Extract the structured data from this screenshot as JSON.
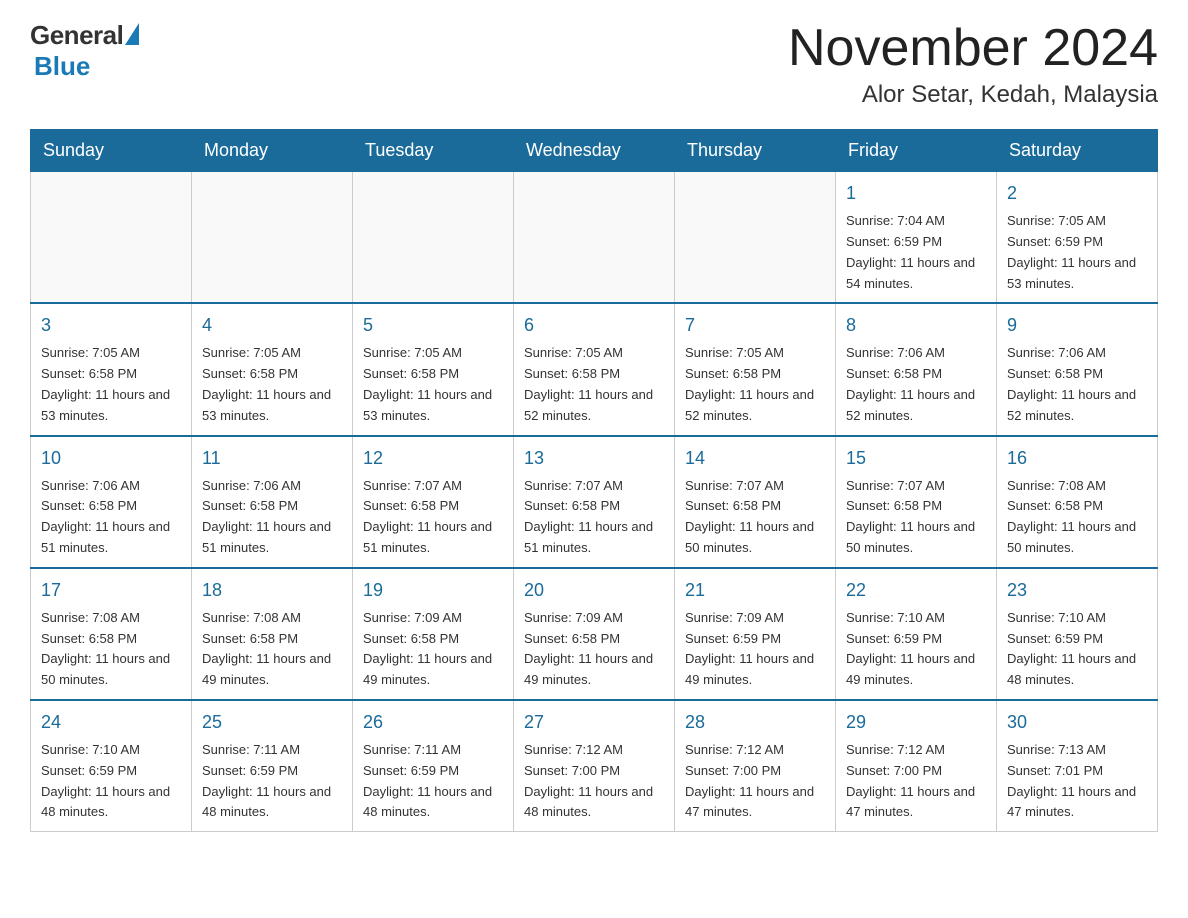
{
  "header": {
    "logo_general": "General",
    "logo_blue": "Blue",
    "month_title": "November 2024",
    "location": "Alor Setar, Kedah, Malaysia"
  },
  "days_of_week": [
    "Sunday",
    "Monday",
    "Tuesday",
    "Wednesday",
    "Thursday",
    "Friday",
    "Saturday"
  ],
  "weeks": [
    [
      {
        "day": "",
        "info": ""
      },
      {
        "day": "",
        "info": ""
      },
      {
        "day": "",
        "info": ""
      },
      {
        "day": "",
        "info": ""
      },
      {
        "day": "",
        "info": ""
      },
      {
        "day": "1",
        "info": "Sunrise: 7:04 AM\nSunset: 6:59 PM\nDaylight: 11 hours and 54 minutes."
      },
      {
        "day": "2",
        "info": "Sunrise: 7:05 AM\nSunset: 6:59 PM\nDaylight: 11 hours and 53 minutes."
      }
    ],
    [
      {
        "day": "3",
        "info": "Sunrise: 7:05 AM\nSunset: 6:58 PM\nDaylight: 11 hours and 53 minutes."
      },
      {
        "day": "4",
        "info": "Sunrise: 7:05 AM\nSunset: 6:58 PM\nDaylight: 11 hours and 53 minutes."
      },
      {
        "day": "5",
        "info": "Sunrise: 7:05 AM\nSunset: 6:58 PM\nDaylight: 11 hours and 53 minutes."
      },
      {
        "day": "6",
        "info": "Sunrise: 7:05 AM\nSunset: 6:58 PM\nDaylight: 11 hours and 52 minutes."
      },
      {
        "day": "7",
        "info": "Sunrise: 7:05 AM\nSunset: 6:58 PM\nDaylight: 11 hours and 52 minutes."
      },
      {
        "day": "8",
        "info": "Sunrise: 7:06 AM\nSunset: 6:58 PM\nDaylight: 11 hours and 52 minutes."
      },
      {
        "day": "9",
        "info": "Sunrise: 7:06 AM\nSunset: 6:58 PM\nDaylight: 11 hours and 52 minutes."
      }
    ],
    [
      {
        "day": "10",
        "info": "Sunrise: 7:06 AM\nSunset: 6:58 PM\nDaylight: 11 hours and 51 minutes."
      },
      {
        "day": "11",
        "info": "Sunrise: 7:06 AM\nSunset: 6:58 PM\nDaylight: 11 hours and 51 minutes."
      },
      {
        "day": "12",
        "info": "Sunrise: 7:07 AM\nSunset: 6:58 PM\nDaylight: 11 hours and 51 minutes."
      },
      {
        "day": "13",
        "info": "Sunrise: 7:07 AM\nSunset: 6:58 PM\nDaylight: 11 hours and 51 minutes."
      },
      {
        "day": "14",
        "info": "Sunrise: 7:07 AM\nSunset: 6:58 PM\nDaylight: 11 hours and 50 minutes."
      },
      {
        "day": "15",
        "info": "Sunrise: 7:07 AM\nSunset: 6:58 PM\nDaylight: 11 hours and 50 minutes."
      },
      {
        "day": "16",
        "info": "Sunrise: 7:08 AM\nSunset: 6:58 PM\nDaylight: 11 hours and 50 minutes."
      }
    ],
    [
      {
        "day": "17",
        "info": "Sunrise: 7:08 AM\nSunset: 6:58 PM\nDaylight: 11 hours and 50 minutes."
      },
      {
        "day": "18",
        "info": "Sunrise: 7:08 AM\nSunset: 6:58 PM\nDaylight: 11 hours and 49 minutes."
      },
      {
        "day": "19",
        "info": "Sunrise: 7:09 AM\nSunset: 6:58 PM\nDaylight: 11 hours and 49 minutes."
      },
      {
        "day": "20",
        "info": "Sunrise: 7:09 AM\nSunset: 6:58 PM\nDaylight: 11 hours and 49 minutes."
      },
      {
        "day": "21",
        "info": "Sunrise: 7:09 AM\nSunset: 6:59 PM\nDaylight: 11 hours and 49 minutes."
      },
      {
        "day": "22",
        "info": "Sunrise: 7:10 AM\nSunset: 6:59 PM\nDaylight: 11 hours and 49 minutes."
      },
      {
        "day": "23",
        "info": "Sunrise: 7:10 AM\nSunset: 6:59 PM\nDaylight: 11 hours and 48 minutes."
      }
    ],
    [
      {
        "day": "24",
        "info": "Sunrise: 7:10 AM\nSunset: 6:59 PM\nDaylight: 11 hours and 48 minutes."
      },
      {
        "day": "25",
        "info": "Sunrise: 7:11 AM\nSunset: 6:59 PM\nDaylight: 11 hours and 48 minutes."
      },
      {
        "day": "26",
        "info": "Sunrise: 7:11 AM\nSunset: 6:59 PM\nDaylight: 11 hours and 48 minutes."
      },
      {
        "day": "27",
        "info": "Sunrise: 7:12 AM\nSunset: 7:00 PM\nDaylight: 11 hours and 48 minutes."
      },
      {
        "day": "28",
        "info": "Sunrise: 7:12 AM\nSunset: 7:00 PM\nDaylight: 11 hours and 47 minutes."
      },
      {
        "day": "29",
        "info": "Sunrise: 7:12 AM\nSunset: 7:00 PM\nDaylight: 11 hours and 47 minutes."
      },
      {
        "day": "30",
        "info": "Sunrise: 7:13 AM\nSunset: 7:01 PM\nDaylight: 11 hours and 47 minutes."
      }
    ]
  ]
}
